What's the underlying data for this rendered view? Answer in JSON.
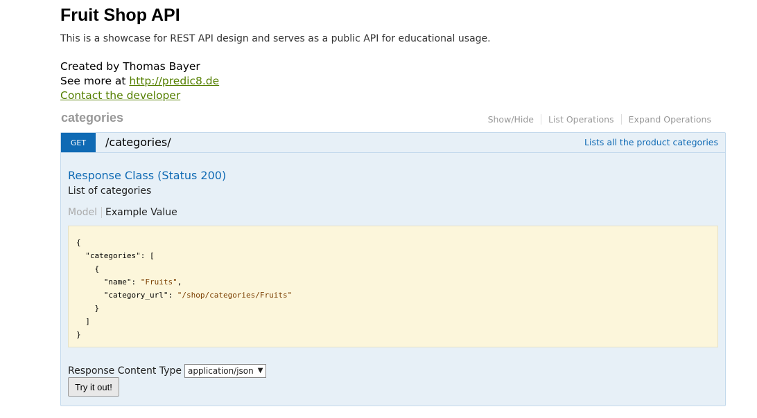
{
  "info": {
    "title": "Fruit Shop API",
    "description": "This is a showcase for REST API design and serves as a public API for educational usage.",
    "created_by": "Created by Thomas Bayer",
    "see_more_prefix": "See more at ",
    "see_more_link": "http://predic8.de",
    "contact_link": "Contact the developer"
  },
  "section": {
    "heading": "categories",
    "links": [
      "Show/Hide",
      "List Operations",
      "Expand Operations"
    ]
  },
  "operation": {
    "method": "GET",
    "path": "/categories/",
    "summary": "Lists all the product categories",
    "response_class_title": "Response Class (Status 200)",
    "response_class_desc": "List of categories",
    "tab_model": "Model",
    "tab_example": "Example Value",
    "example": {
      "line1": "{",
      "key_categories": "\"categories\"",
      "open_array": ": [",
      "open_obj": "{",
      "key_name": "\"name\"",
      "val_name": "\"Fruits\"",
      "key_url": "\"category_url\"",
      "val_url": "\"/shop/categories/Fruits\"",
      "close_obj": "}",
      "close_array": "]",
      "close_root": "}"
    },
    "content_type_label": "Response Content Type",
    "content_type_value": "application/json",
    "try_button": "Try it out!"
  },
  "colors": {
    "get_method": "#0f6ab4",
    "op_background": "#e7f0f7",
    "snippet_background": "#fcf6db",
    "link": "#547f00"
  },
  "icons": {
    "select_arrow": "triangle-down-icon"
  }
}
